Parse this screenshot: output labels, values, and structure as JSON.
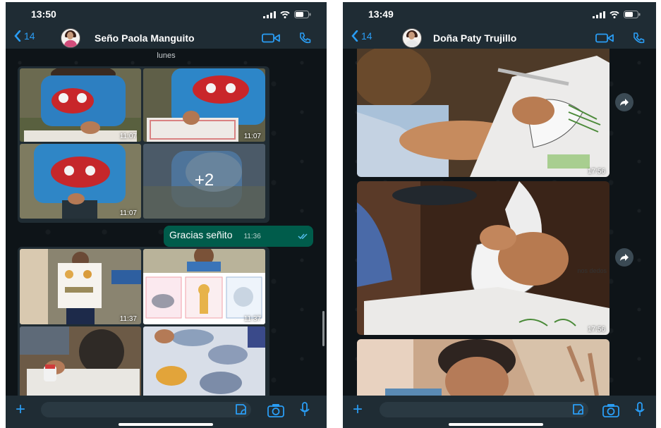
{
  "left_phone": {
    "time": "13:50",
    "back_count": "14",
    "contact_name": "Seño Paola Manguito",
    "day_label": "lunes",
    "album1_times": [
      "11:07",
      "11:07",
      "11:07"
    ],
    "album1_more": "+2",
    "message": {
      "text": "Gracias señito",
      "time": "11:36"
    },
    "album2_times": [
      "11:37",
      "11:37"
    ]
  },
  "right_phone": {
    "time": "13:49",
    "back_count": "14",
    "contact_name": "Doña Paty Trujillo",
    "photo_times": [
      "17:56",
      "17:56"
    ],
    "photo_text": "nos dedos"
  },
  "colors": {
    "accent": "#2a9df4",
    "header_bg": "#1f2c34",
    "chat_bg": "#0e1418",
    "outgoing_bubble": "#005c4b"
  },
  "icons": [
    "chevron-left-icon",
    "video-call-icon",
    "phone-icon",
    "plus-icon",
    "sticker-icon",
    "camera-icon",
    "microphone-icon",
    "forward-icon",
    "signal-icon",
    "wifi-icon",
    "battery-icon",
    "double-check-icon"
  ]
}
